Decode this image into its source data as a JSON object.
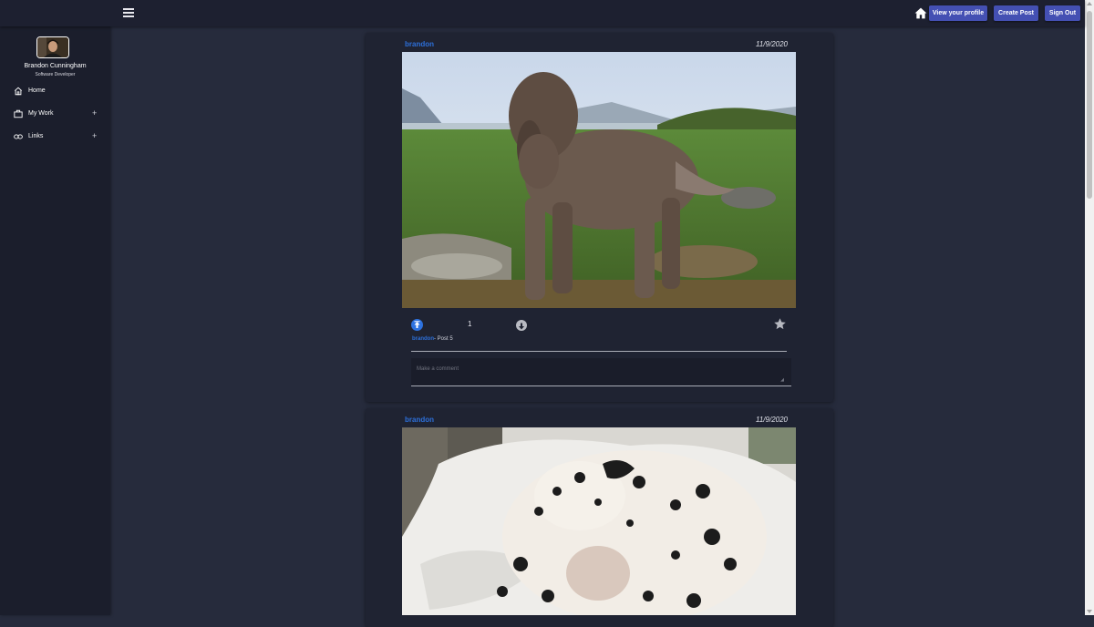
{
  "topbar": {
    "menu_icon": "hamburger-menu-icon",
    "home_icon": "home-icon",
    "buttons": [
      "View your profile",
      "Create Post",
      "Sign Out"
    ],
    "accent_color": "#4450b3"
  },
  "sidebar": {
    "user": {
      "name": "Brandon Cunningham",
      "role": "Software Developer"
    },
    "items": [
      {
        "label": "Home",
        "icon": "home-icon",
        "expandable": false
      },
      {
        "label": "My Work",
        "icon": "briefcase-icon",
        "expandable": true
      },
      {
        "label": "Links",
        "icon": "link-icon",
        "expandable": true
      }
    ],
    "expand_symbol": "+"
  },
  "posts": [
    {
      "author": "brandon",
      "date": "11/9/2020",
      "image": "curly brown dog standing on a grassy hillside with mountains and water",
      "votes": "1",
      "caption_user": "brandon",
      "caption_text": "- Post 5",
      "comment_placeholder": "Make a comment"
    },
    {
      "author": "brandon",
      "date": "11/9/2020",
      "image": "dalmatian curled up asleep on white bedding"
    }
  ],
  "colors": {
    "link_blue": "#2d6fd8",
    "upvote_blue": "#2d72e0",
    "page_bg": "#262b3c",
    "card_bg": "#1f2332"
  }
}
